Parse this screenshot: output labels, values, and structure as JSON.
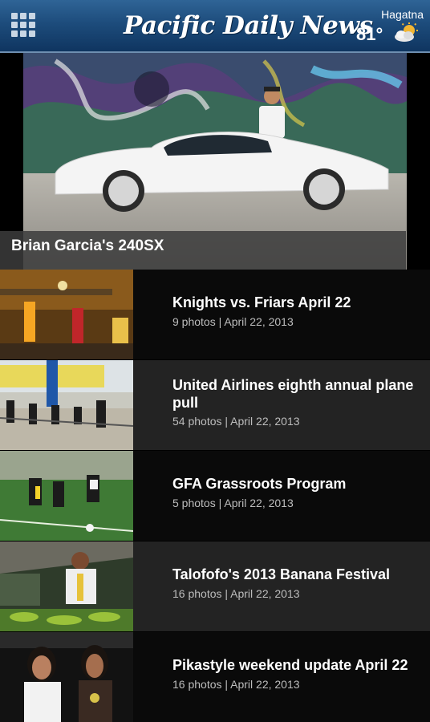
{
  "header": {
    "logo": "Pacific Daily News",
    "location": "Hagatna",
    "temperature": "81°",
    "weather_icon": "partly-cloudy-icon",
    "brand_color": "#1d4c7c"
  },
  "featured": {
    "title": "Brian Garcia's 240SX"
  },
  "galleries": [
    {
      "title": "Knights vs. Friars April 22",
      "meta": "9 photos | April 22, 2013"
    },
    {
      "title": "United Airlines eighth annual plane pull",
      "meta": "54 photos | April 22, 2013"
    },
    {
      "title": "GFA Grassroots Program",
      "meta": "5 photos | April 22, 2013"
    },
    {
      "title": "Talofofo's 2013 Banana Festival",
      "meta": "16 photos | April 22, 2013"
    },
    {
      "title": "Pikastyle weekend update April 22",
      "meta": "16 photos | April 22, 2013"
    }
  ]
}
